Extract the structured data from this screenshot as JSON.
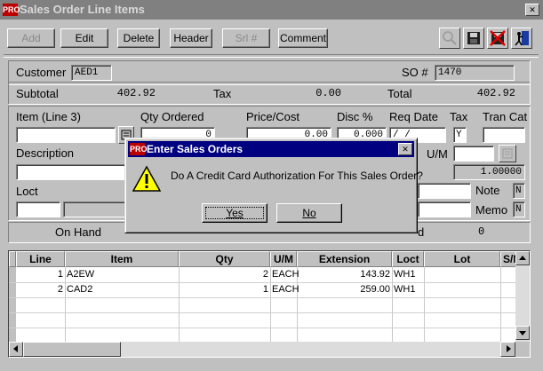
{
  "window": {
    "title": "Sales Order Line Items",
    "app_icon": "PRO"
  },
  "toolbar": {
    "add": "Add",
    "edit": "Edit",
    "delete": "Delete",
    "header": "Header",
    "srl": "Srl #",
    "comment": "Comment",
    "icons": [
      "search-icon",
      "save-icon",
      "cancel-icon",
      "exit-icon"
    ]
  },
  "header": {
    "customer_label": "Customer",
    "customer_value": "AED1",
    "so_label": "SO #",
    "so_value": "1470",
    "subtotal_label": "Subtotal",
    "subtotal_value": "402.92",
    "tax_label": "Tax",
    "tax_value": "0.00",
    "total_label": "Total",
    "total_value": "402.92"
  },
  "form": {
    "item_label": "Item (Line 3)",
    "qty_label": "Qty Ordered",
    "price_label": "Price/Cost",
    "disc_label": "Disc %",
    "reqdate_label": "Req Date",
    "tax_label": "Tax",
    "trancat_label": "Tran Cat",
    "qty_value": "0",
    "price_value": "0.00",
    "disc_value": "0.000",
    "reqdate_value": "/ /",
    "tax_value": "Y",
    "description_label": "Description",
    "um_label": "U/M",
    "factor_value": "1.00000",
    "loct_label": "Loct",
    "note_label": "Note",
    "note_value": "N",
    "memo_label": "Memo",
    "memo_value": "N",
    "onhand_label": "On Hand",
    "partial_label": "d",
    "allocated_value": "0"
  },
  "grid": {
    "columns": [
      "Line",
      "Item",
      "Qty",
      "U/M",
      "Extension",
      "Loct",
      "Lot",
      "S/N"
    ],
    "rows": [
      {
        "line": "1",
        "item": "A2EW",
        "qty": "2",
        "um": "EACH",
        "extension": "143.92",
        "loct": "WH1",
        "lot": "",
        "sn": ""
      },
      {
        "line": "2",
        "item": "CAD2",
        "qty": "1",
        "um": "EACH",
        "extension": "259.00",
        "loct": "WH1",
        "lot": "",
        "sn": ""
      }
    ]
  },
  "dialog": {
    "title": "Enter Sales Orders",
    "message": "Do A Credit Card Authorization For This Sales Order?",
    "yes": "Yes",
    "no": "No",
    "icon": "warning-icon"
  },
  "colors": {
    "title_active": "#000080",
    "title_inactive": "#808080",
    "face": "#c0c0c0"
  }
}
